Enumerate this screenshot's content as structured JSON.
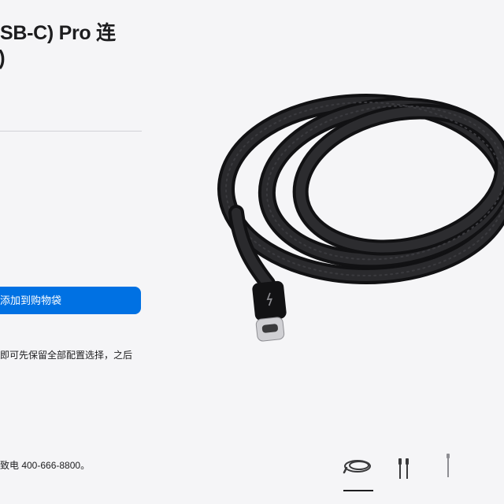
{
  "product": {
    "title_line1": "SB-C) Pro 连",
    "title_line2": ")"
  },
  "actions": {
    "add_to_bag_label": "添加到购物袋"
  },
  "notes": {
    "save_config_text": "即可先保留全部配置选择，之后"
  },
  "contact": {
    "phone_text": "致电 400-666-8800。"
  },
  "gallery": {
    "selected_index": 0,
    "thumbnails": [
      {
        "icon": "coiled-cable-icon"
      },
      {
        "icon": "cable-connectors-icon"
      },
      {
        "icon": "straight-cable-icon"
      }
    ]
  },
  "colors": {
    "accent": "#0071e3",
    "background": "#f5f5f7",
    "text": "#1d1d1f",
    "divider": "#d2d2d7",
    "cable": "#1c1c1e"
  }
}
